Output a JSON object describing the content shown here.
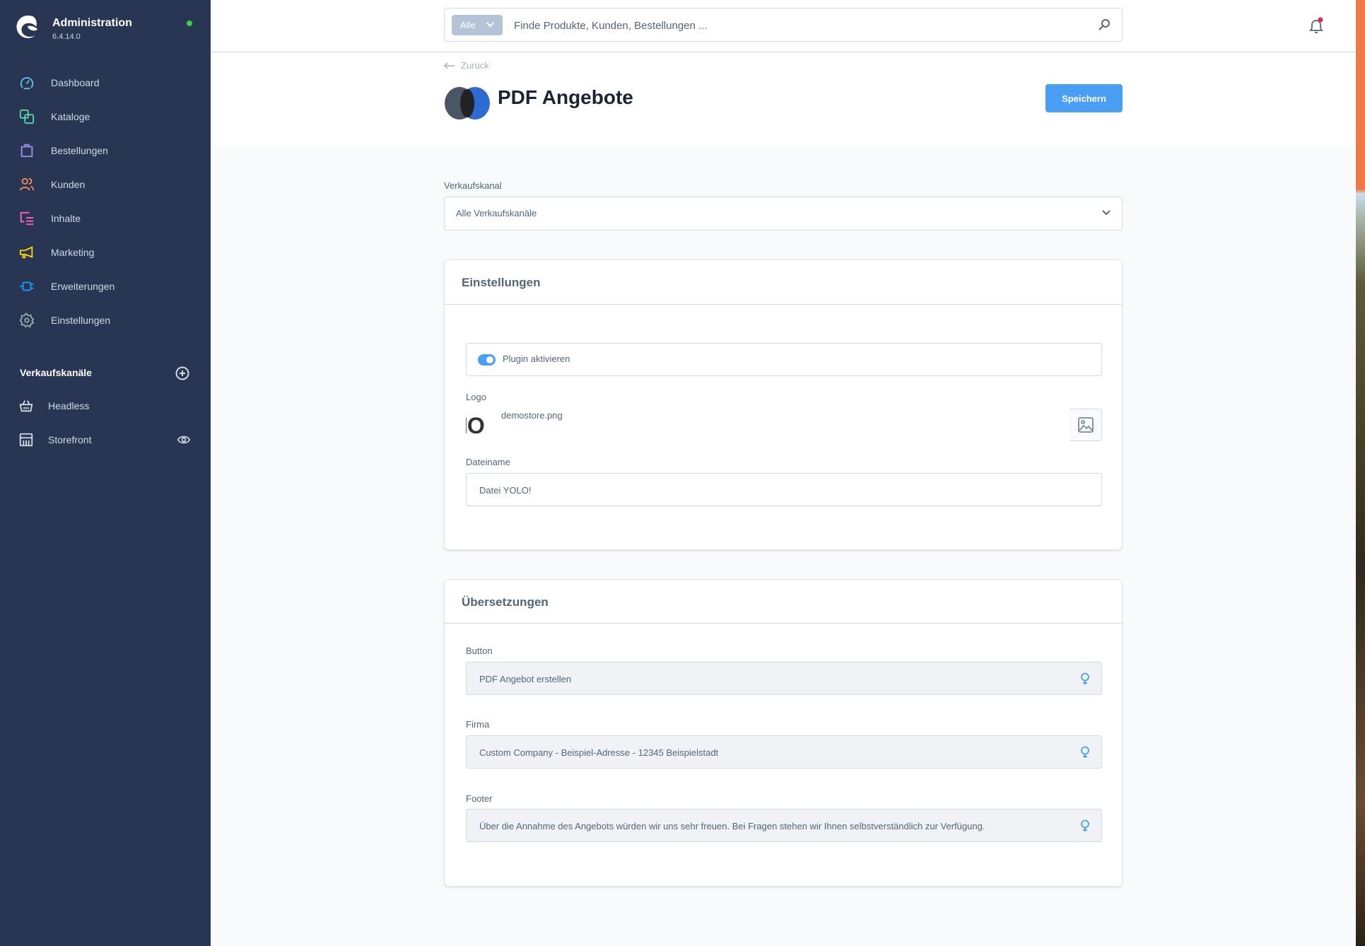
{
  "app": {
    "title": "Administration",
    "version": "6.4.14.0",
    "status_color": "#37d046"
  },
  "sidebar": {
    "items": [
      {
        "label": "Dashboard",
        "icon": "dashboard-icon",
        "color": "#62c2ea"
      },
      {
        "label": "Kataloge",
        "icon": "catalog-icon",
        "color": "#57d9a3"
      },
      {
        "label": "Bestellungen",
        "icon": "orders-icon",
        "color": "#a092f0"
      },
      {
        "label": "Kunden",
        "icon": "customers-icon",
        "color": "#f88962"
      },
      {
        "label": "Inhalte",
        "icon": "content-icon",
        "color": "#ff68b4"
      },
      {
        "label": "Marketing",
        "icon": "marketing-icon",
        "color": "#ffd700"
      },
      {
        "label": "Erweiterungen",
        "icon": "extensions-icon",
        "color": "#189eff"
      },
      {
        "label": "Einstellungen",
        "icon": "settings-icon",
        "color": "#9aa8b5"
      }
    ],
    "sales_channels": {
      "heading": "Verkaufskanäle",
      "items": [
        {
          "label": "Headless",
          "icon": "basket-icon"
        },
        {
          "label": "Storefront",
          "icon": "storefront-icon"
        }
      ]
    }
  },
  "topbar": {
    "search_type": "Alle",
    "search_placeholder": "Finde Produkte, Kunden, Bestellungen ...",
    "notification_badge_color": "#de294c"
  },
  "header": {
    "back_label": "Zurück",
    "title": "PDF Angebote",
    "save_label": "Speichern",
    "accent": "#4a9ff5"
  },
  "sales_channel_select": {
    "label": "Verkaufskanal",
    "value": "Alle Verkaufskanäle"
  },
  "settings_card": {
    "title": "Einstellungen",
    "plugin_toggle": {
      "label": "Plugin aktivieren",
      "checked": true
    },
    "logo": {
      "label": "Logo",
      "file_name": "demostore.png",
      "thumb_text": "IO"
    },
    "file_name": {
      "label": "Dateiname",
      "value": "Datei YOLO!"
    }
  },
  "translations_card": {
    "title": "Übersetzungen",
    "fields": [
      {
        "label": "Button",
        "value": "PDF Angebot erstellen"
      },
      {
        "label": "Firma",
        "value": "Custom Company - Beispiel-Adresse - 12345 Beispielstadt"
      },
      {
        "label": "Footer",
        "value": "Über die Annahme des Angebots würden wir uns sehr freuen. Bei Fragen stehen wir Ihnen selbstverständlich zur Verfügung."
      }
    ]
  }
}
